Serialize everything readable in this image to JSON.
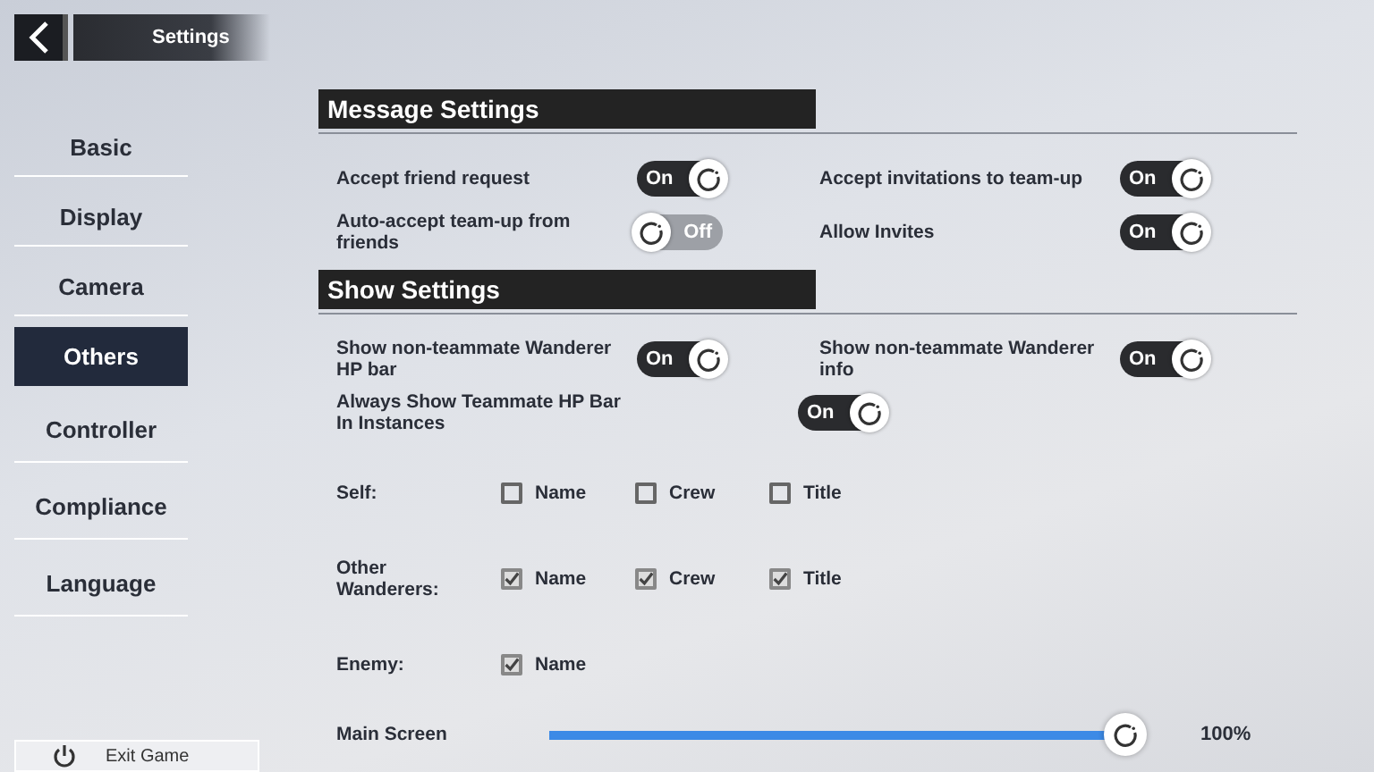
{
  "header": {
    "title": "Settings"
  },
  "sidebar": {
    "items": [
      {
        "label": "Basic",
        "selected": false
      },
      {
        "label": "Display",
        "selected": false
      },
      {
        "label": "Camera",
        "selected": false
      },
      {
        "label": "Others",
        "selected": true
      },
      {
        "label": "Controller",
        "selected": false
      },
      {
        "label": "Compliance",
        "selected": false
      },
      {
        "label": "Language",
        "selected": false
      }
    ]
  },
  "exit_button": {
    "label": "Exit Game"
  },
  "sections": [
    {
      "title": "Message Settings",
      "toggles": [
        {
          "label": "Accept friend request",
          "on": true,
          "state_label": "On",
          "kind": "normal"
        },
        {
          "label": "Accept invitations to team-up",
          "on": true,
          "state_label": "On",
          "kind": "normal"
        },
        {
          "label": "Auto-accept team-up from friends",
          "on": false,
          "state_label": "Off",
          "kind": "normal"
        },
        {
          "label": "Allow Invites",
          "on": true,
          "state_label": "On",
          "kind": "normal"
        }
      ]
    },
    {
      "title": "Show Settings",
      "toggles": [
        {
          "label": "Show non-teammate Wanderer HP bar",
          "on": true,
          "state_label": "On",
          "kind": "normal"
        },
        {
          "label": "Show non-teammate Wanderer info",
          "on": true,
          "state_label": "On",
          "kind": "normal"
        },
        {
          "label": "Always Show Teammate HP Bar In Instances",
          "on": true,
          "state_label": "On",
          "kind": "wide"
        }
      ],
      "check_rows": [
        {
          "label": "Self:",
          "options": [
            {
              "label": "Name",
              "checked": false
            },
            {
              "label": "Crew",
              "checked": false
            },
            {
              "label": "Title",
              "checked": false
            }
          ]
        },
        {
          "label": "Other Wanderers:",
          "options": [
            {
              "label": "Name",
              "checked": true
            },
            {
              "label": "Crew",
              "checked": true
            },
            {
              "label": "Title",
              "checked": true
            }
          ]
        },
        {
          "label": "Enemy:",
          "options": [
            {
              "label": "Name",
              "checked": true
            }
          ]
        }
      ],
      "slider": {
        "label": "Main Screen",
        "level": 1,
        "reading": "100%"
      }
    }
  ]
}
